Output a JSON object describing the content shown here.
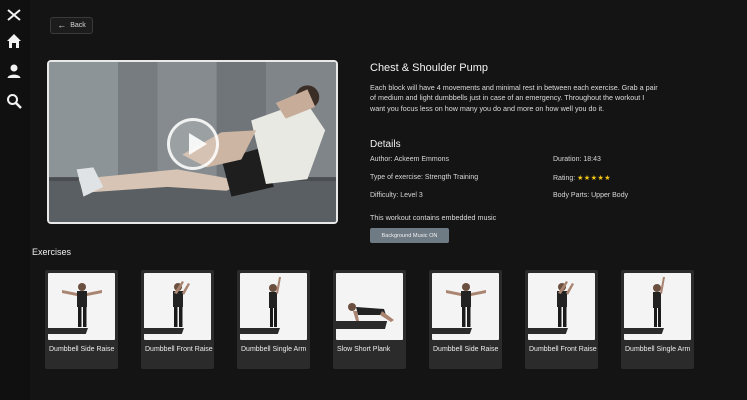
{
  "sidebar": {
    "icons": [
      "close-icon",
      "home-icon",
      "profile-icon",
      "search-icon"
    ]
  },
  "back_button": {
    "label": "Back"
  },
  "workout": {
    "title": "Chest & Shoulder Pump",
    "description": "Each block will have 4 movements and minimal rest in between each exercise. Grab a pair of medium and light dumbbells just in case of an emergency. Throughout the workout I want you focus less on how many you do and more on how well you do it.",
    "details_heading": "Details",
    "author": "Author: Ackeem Emmons",
    "duration": "Duration: 18:43",
    "type": "Type of exercise: Strength Training",
    "rating_label": "Rating:",
    "rating_stars": "★★★★★",
    "rating_value": 5,
    "difficulty": "Difficulty: Level 3",
    "body_parts": "Body Parts: Upper Body",
    "music_note": "This workout contains embedded music",
    "music_button": "Background Music ON"
  },
  "exercises": {
    "heading": "Exercises",
    "items": [
      {
        "label": "Dumbbell Side Raise",
        "pose": "side-raise"
      },
      {
        "label": "Dumbbell Front Raise",
        "pose": "front-raise"
      },
      {
        "label": "Dumbbell Single Arm",
        "pose": "single-arm"
      },
      {
        "label": "Slow Short Plank",
        "pose": "plank"
      },
      {
        "label": "Dumbbell Side Raise",
        "pose": "side-raise"
      },
      {
        "label": "Dumbbell Front Raise",
        "pose": "front-raise"
      },
      {
        "label": "Dumbbell Single Arm",
        "pose": "single-arm"
      }
    ]
  },
  "colors": {
    "background": "#141414",
    "rating_star": "#f2c418",
    "music_button": "#6e7a84"
  }
}
